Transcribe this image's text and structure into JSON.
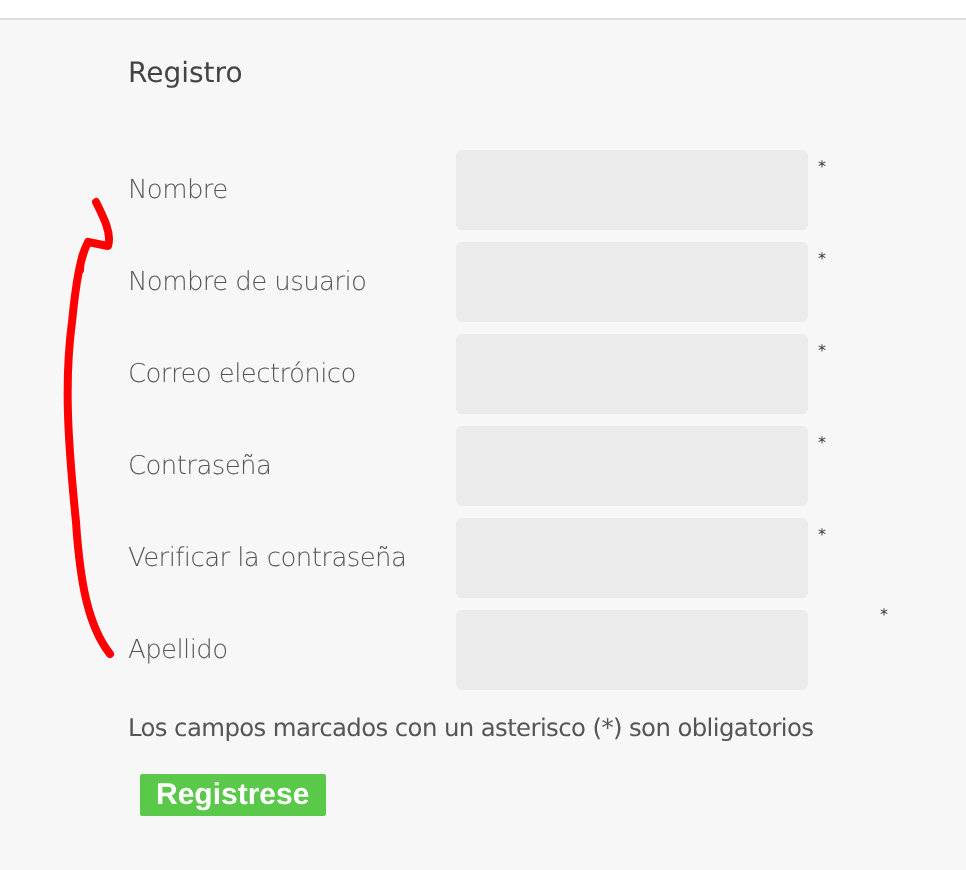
{
  "title": "Registro",
  "fields": [
    {
      "label": "Nombre",
      "asterisk": "*"
    },
    {
      "label": "Nombre de usuario",
      "asterisk": "*"
    },
    {
      "label": "Correo electrónico",
      "asterisk": "*"
    },
    {
      "label": "Contraseña",
      "asterisk": "*"
    },
    {
      "label": "Verificar la contraseña",
      "asterisk": "*"
    },
    {
      "label": "Apellido",
      "asterisk": "*"
    }
  ],
  "note": "Los campos marcados con un asterisco (*) son obligatorios",
  "submit": "Registrese"
}
